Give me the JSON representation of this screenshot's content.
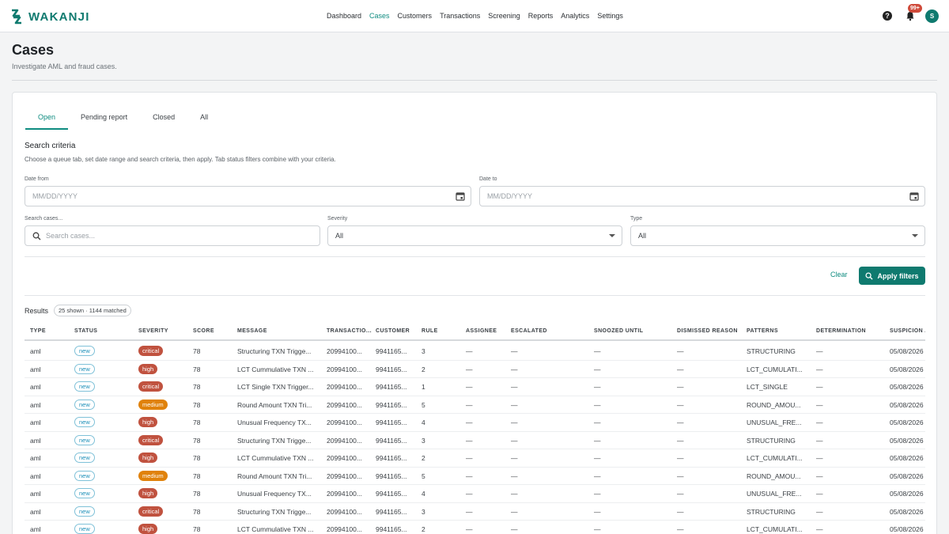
{
  "brand": {
    "name": "WAKANJI",
    "color": "#0f7a6f"
  },
  "nav": {
    "items": [
      "Dashboard",
      "Cases",
      "Customers",
      "Transactions",
      "Screening",
      "Reports",
      "Analytics",
      "Settings"
    ],
    "active": "Cases"
  },
  "topright": {
    "help_icon": "help-icon",
    "bell_icon": "bell-icon",
    "notifications_badge": "99+",
    "avatar_initial": "S"
  },
  "page": {
    "title": "Cases",
    "subtitle": "Investigate AML and fraud cases."
  },
  "tabs": [
    "Open",
    "Pending report",
    "Closed",
    "All"
  ],
  "active_tab": "Open",
  "criteria": {
    "title": "Search criteria",
    "help": "Choose a queue tab, set date range and search criteria, then apply. Tab status filters combine with your criteria.",
    "date_from_label": "Date from",
    "date_from_placeholder": "MM/DD/YYYY",
    "date_to_label": "Date to",
    "date_to_placeholder": "MM/DD/YYYY",
    "search_label": "Search cases...",
    "search_placeholder": "Search cases...",
    "severity_label": "Severity",
    "severity_value": "All",
    "type_label": "Type",
    "type_value": "All"
  },
  "actions": {
    "clear": "Clear",
    "apply": "Apply filters"
  },
  "results": {
    "label": "Results",
    "summary": "25 shown · 1144 matched"
  },
  "colors": {
    "critical": "#c0523f",
    "high": "#c0523f",
    "medium": "#e0820c",
    "accent": "#0f8c80"
  },
  "table": {
    "headers": [
      "TYPE",
      "STATUS",
      "SEVERITY",
      "SCORE",
      "MESSAGE",
      "TRANSACTIO...",
      "CUSTOMER",
      "RULE",
      "ASSIGNEE",
      "ESCALATED",
      "SNOOZED UNTIL",
      "DISMISSED REASON",
      "PATTERNS",
      "DETERMINATION",
      "SUSPICION A"
    ],
    "rows": [
      {
        "type": "aml",
        "status": "new",
        "severity": "critical",
        "score": "78",
        "message": "Structuring TXN Trigge...",
        "transaction": "20994100...",
        "customer": "9941165...",
        "rule": "3",
        "assignee": "—",
        "escalated": "—",
        "snoozed": "—",
        "dismissed": "—",
        "patterns": "STRUCTURING",
        "determination": "—",
        "suspicion": "05/08/2026"
      },
      {
        "type": "aml",
        "status": "new",
        "severity": "high",
        "score": "78",
        "message": "LCT Cummulative TXN ...",
        "transaction": "20994100...",
        "customer": "9941165...",
        "rule": "2",
        "assignee": "—",
        "escalated": "—",
        "snoozed": "—",
        "dismissed": "—",
        "patterns": "LCT_CUMULATI...",
        "determination": "—",
        "suspicion": "05/08/2026"
      },
      {
        "type": "aml",
        "status": "new",
        "severity": "critical",
        "score": "78",
        "message": "LCT Single TXN Trigger...",
        "transaction": "20994100...",
        "customer": "9941165...",
        "rule": "1",
        "assignee": "—",
        "escalated": "—",
        "snoozed": "—",
        "dismissed": "—",
        "patterns": "LCT_SINGLE",
        "determination": "—",
        "suspicion": "05/08/2026"
      },
      {
        "type": "aml",
        "status": "new",
        "severity": "medium",
        "score": "78",
        "message": "Round Amount TXN Tri...",
        "transaction": "20994100...",
        "customer": "9941165...",
        "rule": "5",
        "assignee": "—",
        "escalated": "—",
        "snoozed": "—",
        "dismissed": "—",
        "patterns": "ROUND_AMOU...",
        "determination": "—",
        "suspicion": "05/08/2026"
      },
      {
        "type": "aml",
        "status": "new",
        "severity": "high",
        "score": "78",
        "message": "Unusual Frequency TX...",
        "transaction": "20994100...",
        "customer": "9941165...",
        "rule": "4",
        "assignee": "—",
        "escalated": "—",
        "snoozed": "—",
        "dismissed": "—",
        "patterns": "UNUSUAL_FRE...",
        "determination": "—",
        "suspicion": "05/08/2026"
      },
      {
        "type": "aml",
        "status": "new",
        "severity": "critical",
        "score": "78",
        "message": "Structuring TXN Trigge...",
        "transaction": "20994100...",
        "customer": "9941165...",
        "rule": "3",
        "assignee": "—",
        "escalated": "—",
        "snoozed": "—",
        "dismissed": "—",
        "patterns": "STRUCTURING",
        "determination": "—",
        "suspicion": "05/08/2026"
      },
      {
        "type": "aml",
        "status": "new",
        "severity": "high",
        "score": "78",
        "message": "LCT Cummulative TXN ...",
        "transaction": "20994100...",
        "customer": "9941165...",
        "rule": "2",
        "assignee": "—",
        "escalated": "—",
        "snoozed": "—",
        "dismissed": "—",
        "patterns": "LCT_CUMULATI...",
        "determination": "—",
        "suspicion": "05/08/2026"
      },
      {
        "type": "aml",
        "status": "new",
        "severity": "medium",
        "score": "78",
        "message": "Round Amount TXN Tri...",
        "transaction": "20994100...",
        "customer": "9941165...",
        "rule": "5",
        "assignee": "—",
        "escalated": "—",
        "snoozed": "—",
        "dismissed": "—",
        "patterns": "ROUND_AMOU...",
        "determination": "—",
        "suspicion": "05/08/2026"
      },
      {
        "type": "aml",
        "status": "new",
        "severity": "high",
        "score": "78",
        "message": "Unusual Frequency TX...",
        "transaction": "20994100...",
        "customer": "9941165...",
        "rule": "4",
        "assignee": "—",
        "escalated": "—",
        "snoozed": "—",
        "dismissed": "—",
        "patterns": "UNUSUAL_FRE...",
        "determination": "—",
        "suspicion": "05/08/2026"
      },
      {
        "type": "aml",
        "status": "new",
        "severity": "critical",
        "score": "78",
        "message": "Structuring TXN Trigge...",
        "transaction": "20994100...",
        "customer": "9941165...",
        "rule": "3",
        "assignee": "—",
        "escalated": "—",
        "snoozed": "—",
        "dismissed": "—",
        "patterns": "STRUCTURING",
        "determination": "—",
        "suspicion": "05/08/2026"
      },
      {
        "type": "aml",
        "status": "new",
        "severity": "high",
        "score": "78",
        "message": "LCT Cummulative TXN ...",
        "transaction": "20994100...",
        "customer": "9941165...",
        "rule": "2",
        "assignee": "—",
        "escalated": "—",
        "snoozed": "—",
        "dismissed": "—",
        "patterns": "LCT_CUMULATI...",
        "determination": "—",
        "suspicion": "05/08/2026"
      }
    ]
  }
}
